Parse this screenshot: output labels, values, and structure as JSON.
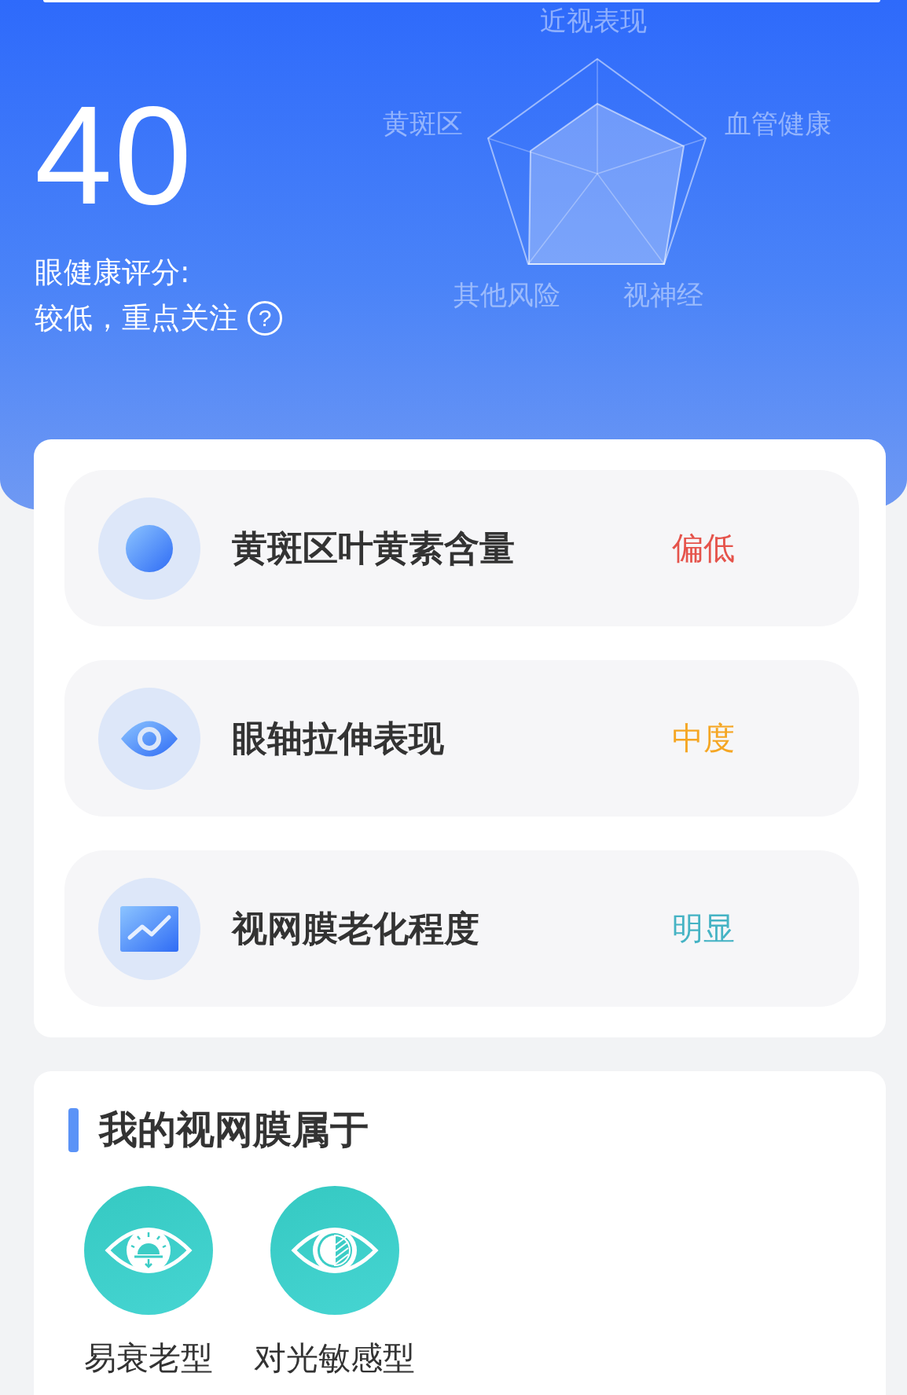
{
  "score": {
    "value": "40",
    "label": "眼健康评分:",
    "status": "较低，重点关注",
    "help": "?"
  },
  "radar": {
    "labels": [
      "近视表现",
      "血管健康",
      "视神经",
      "其他风险",
      "黄斑区"
    ]
  },
  "indicators": [
    {
      "kind": "dot",
      "name": "黄斑区叶黄素含量",
      "value": "偏低",
      "color": "#e5534b"
    },
    {
      "kind": "eye",
      "name": "眼轴拉伸表现",
      "value": "中度",
      "color": "#f5a623"
    },
    {
      "kind": "chart",
      "name": "视网膜老化程度",
      "value": "明显",
      "color": "#45b3c4"
    }
  ],
  "retina_types": {
    "title": "我的视网膜属于",
    "items": [
      {
        "kind": "aging",
        "label": "易衰老型"
      },
      {
        "kind": "light",
        "label": "对光敏感型"
      }
    ]
  }
}
